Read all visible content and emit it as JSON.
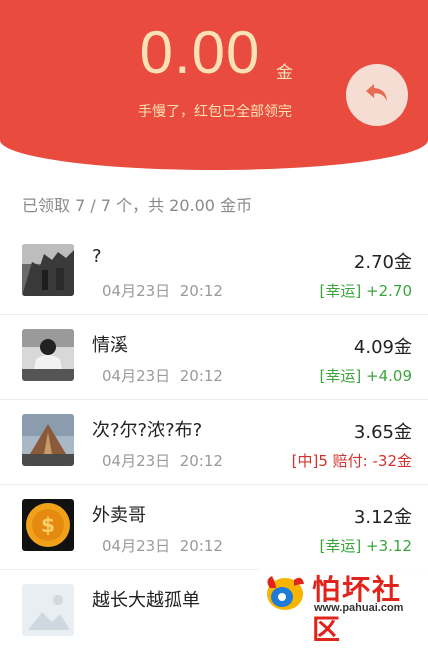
{
  "header": {
    "amount": "0.00",
    "unit": "金",
    "status": "手慢了，红包已全部领完",
    "back_icon": "reply-arrow-icon"
  },
  "summary": "已领取 7 / 7 个，共 20.00 金币",
  "records": [
    {
      "name": "?",
      "date": "04月23日",
      "time": "20:12",
      "amount": "2.70金",
      "tag": "[幸运] +2.70",
      "tag_type": "lucky"
    },
    {
      "name": "情溪",
      "date": "04月23日",
      "time": "20:12",
      "amount": "4.09金",
      "tag": "[幸运] +4.09",
      "tag_type": "lucky"
    },
    {
      "name": "次?尔?浓?布?",
      "date": "04月23日",
      "time": "20:12",
      "amount": "3.65金",
      "tag": "[中]5 赔付: -32金",
      "tag_type": "lose"
    },
    {
      "name": "外卖哥",
      "date": "04月23日",
      "time": "20:12",
      "amount": "3.12金",
      "tag": "[幸运] +3.12",
      "tag_type": "lucky"
    },
    {
      "name": "越长大越孤单",
      "date": "",
      "time": "",
      "amount": "",
      "tag": "",
      "tag_type": ""
    }
  ],
  "watermark": {
    "title": "怕坏社区",
    "url": "www.pahuai.com"
  },
  "colors": {
    "header_red": "#ea4b3f",
    "gold_text": "#fbe2b6",
    "lucky_green": "#3aa63a",
    "lose_red": "#d2332e"
  }
}
